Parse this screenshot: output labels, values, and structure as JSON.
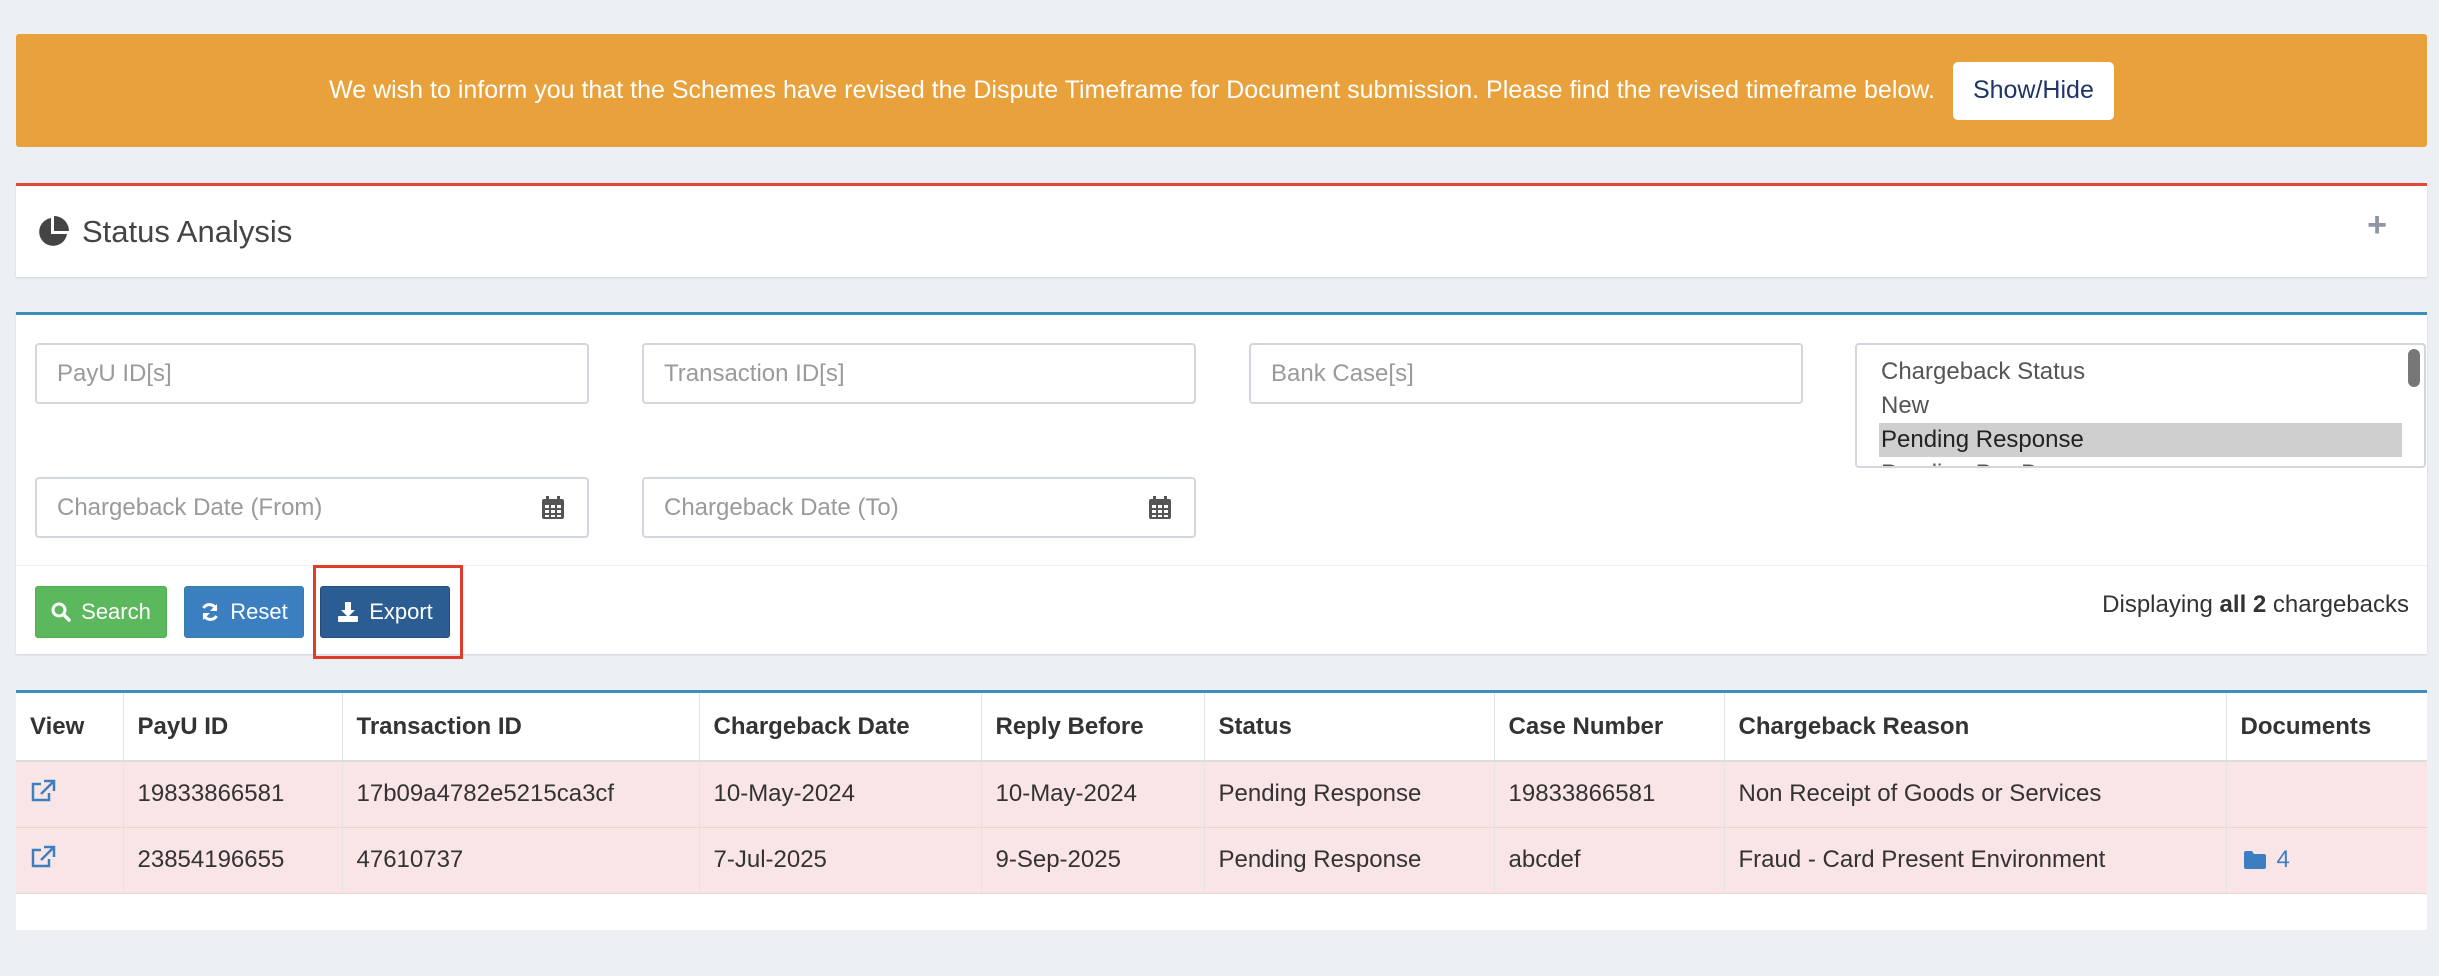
{
  "banner": {
    "message": "We wish to inform you that the Schemes have revised the Dispute Timeframe for Document submission. Please find the revised timeframe below.",
    "toggle_label": "Show/Hide"
  },
  "status_analysis": {
    "title": "Status Analysis",
    "expand_icon": "plus-icon"
  },
  "filters": {
    "payu_ids_placeholder": "PayU ID[s]",
    "transaction_ids_placeholder": "Transaction ID[s]",
    "bank_cases_placeholder": "Bank Case[s]",
    "date_from_placeholder": "Chargeback Date (From)",
    "date_to_placeholder": "Chargeback Date (To)",
    "status_options": [
      "Chargeback Status",
      "New",
      "Pending Response",
      "Pending Pre-Dec..."
    ],
    "selected_status": "Pending Response"
  },
  "actions": {
    "search_label": "Search",
    "reset_label": "Reset",
    "export_label": "Export",
    "display_prefix": "Displaying",
    "display_bold": "all 2",
    "display_suffix": "chargebacks"
  },
  "table": {
    "headers": [
      "View",
      "PayU ID",
      "Transaction ID",
      "Chargeback Date",
      "Reply Before",
      "Status",
      "Case Number",
      "Chargeback Reason",
      "Documents"
    ],
    "rows": [
      {
        "payu_id": "19833866581",
        "transaction_id": "17b09a4782e5215ca3cf",
        "chargeback_date": "10-May-2024",
        "reply_before": "10-May-2024",
        "status": "Pending Response",
        "case_number": "19833866581",
        "reason": "Non Receipt of Goods or Services",
        "documents": ""
      },
      {
        "payu_id": "23854196655",
        "transaction_id": "47610737",
        "chargeback_date": "7-Jul-2025",
        "reply_before": "9-Sep-2025",
        "status": "Pending Response",
        "case_number": "abcdef",
        "reason": "Fraud - Card Present Environment",
        "documents": "4"
      }
    ]
  },
  "colors": {
    "banner": "#e9a23b",
    "search": "#5cb85c",
    "reset": "#3c7fc1",
    "export": "#2c5d92",
    "highlight": "#e03c2c",
    "row_bg": "#f9e5e6"
  }
}
